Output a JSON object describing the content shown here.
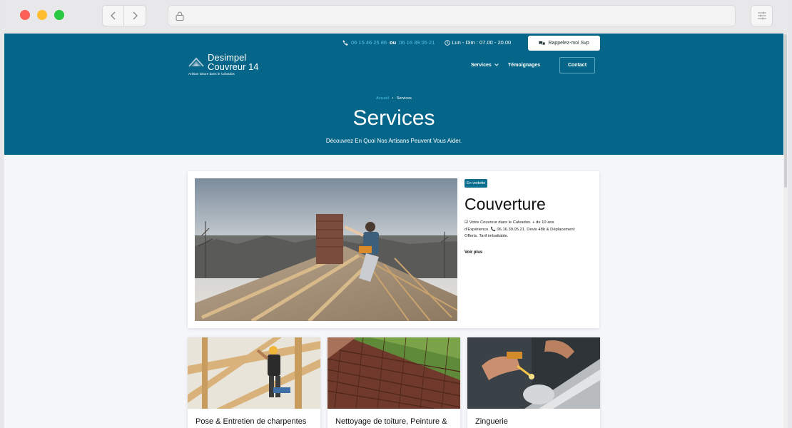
{
  "browser": {
    "url": "",
    "back_icon": "chevron-left-icon",
    "forward_icon": "chevron-right-icon",
    "lock_icon": "lock-icon",
    "settings_icon": "sliders-icon"
  },
  "header": {
    "phone_1": "06 15 46 25 86",
    "separator": "ou",
    "phone_2": "06 16 39 05 21",
    "hours": "Lun - Dim : 07.00 - 20.00",
    "callback_label": "Rappelez-moi Svp",
    "logo_title": "Desimpel Couvreur 14",
    "logo_tagline": "Artisan toiture dans le Calvados",
    "nav": {
      "services": "Services",
      "testimonials": "Témoignages",
      "contact": "Contact"
    },
    "breadcrumb": {
      "home": "Accueil",
      "bullet": "•",
      "current": "Services"
    },
    "title": "Services",
    "subtitle": "Découvrez En Quoi Nos Artisans Peuvent Vous Aider."
  },
  "featured": {
    "badge": "En vedette",
    "title": "Couverture",
    "description": "☑ Votre Couvreur dans le Calvados. + de 10 ans d'Expérience. 📞 06.16.39.05.21. Devis 48h & Déplacement Offerts. Tarif imbattable.",
    "more_label": "Voir plus"
  },
  "cards": [
    {
      "title": "Pose & Entretien de charpentes"
    },
    {
      "title": "Nettoyage de toiture, Peinture &"
    },
    {
      "title": "Zinguerie"
    }
  ],
  "colors": {
    "brand": "#066689",
    "accent_link": "#54c1e4",
    "page_bg": "#f5f6fa"
  }
}
